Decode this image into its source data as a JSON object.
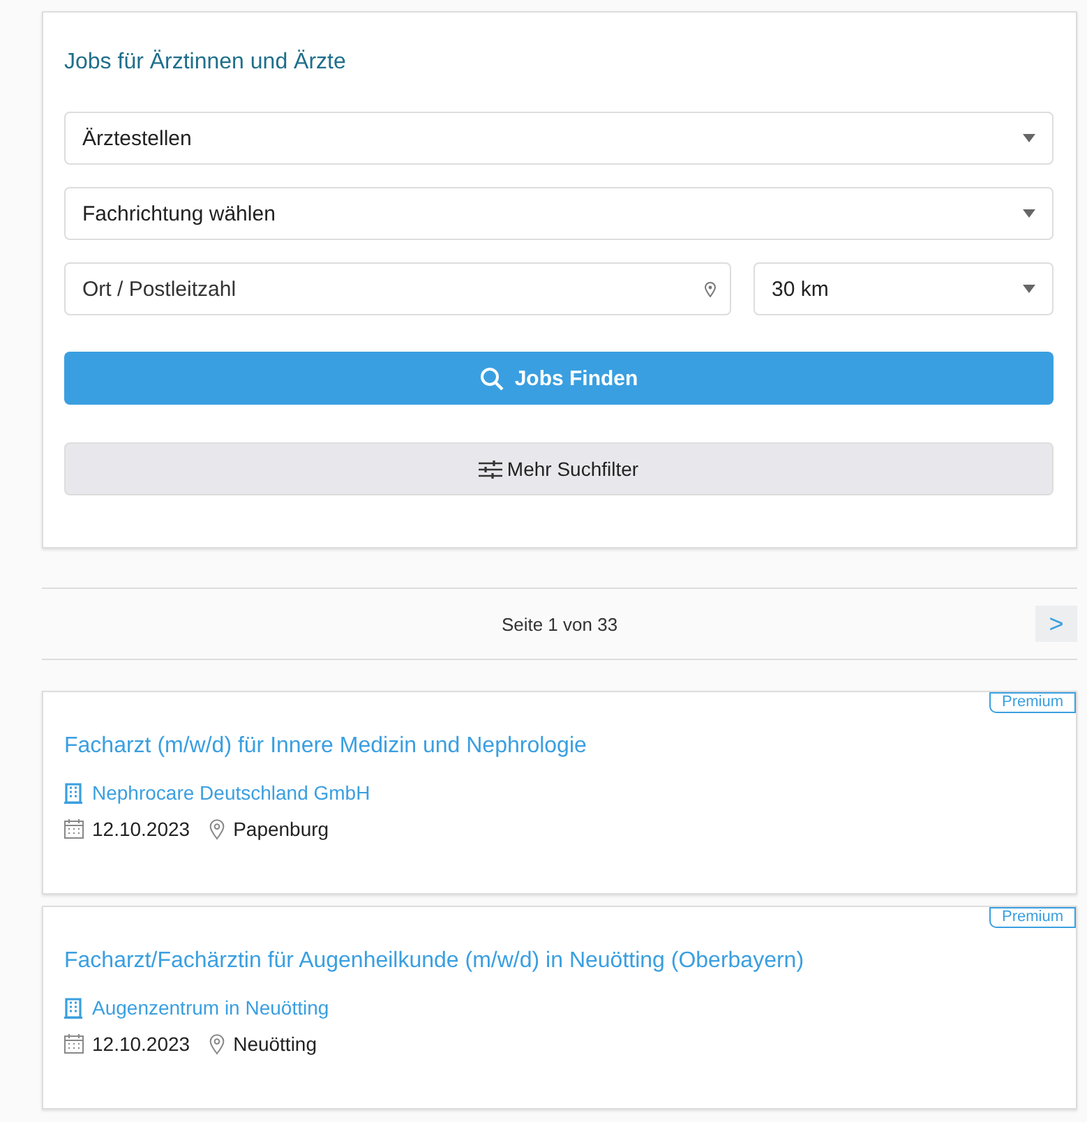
{
  "search": {
    "title": "Jobs für Ärztinnen und Ärzte",
    "category": {
      "value": "Ärztestellen"
    },
    "specialty": {
      "value": "Fachrichtung wählen"
    },
    "location": {
      "placeholder": "Ort / Postleitzahl"
    },
    "radius": {
      "value": "30 km"
    },
    "submit": "Jobs Finden",
    "more_filters": "Mehr Suchfilter"
  },
  "pagination": {
    "label": "Seite 1 von 33",
    "next": ">"
  },
  "jobs": [
    {
      "badge": "Premium",
      "title": "Facharzt (m/w/d) für Innere Medizin und Nephrologie",
      "company": "Nephrocare Deutschland GmbH",
      "date": "12.10.2023",
      "place": "Papenburg"
    },
    {
      "badge": "Premium",
      "title": "Facharzt/Fachärztin für Augenheilkunde (m/w/d) in Neuötting (Oberbayern)",
      "company": "Augenzentrum in Neuötting",
      "date": "12.10.2023",
      "place": "Neuötting"
    }
  ]
}
